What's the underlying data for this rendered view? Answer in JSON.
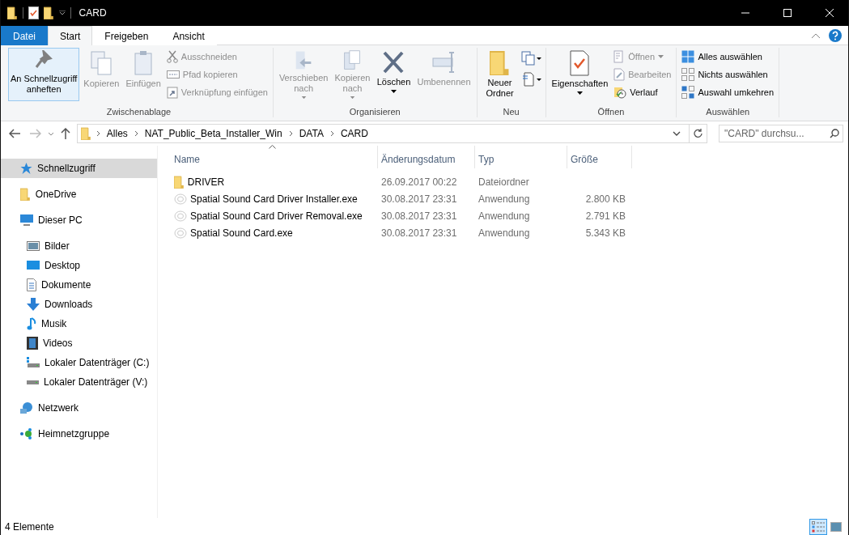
{
  "window": {
    "title": "CARD"
  },
  "ribbon": {
    "tabs": [
      {
        "label": "Datei",
        "kind": "file",
        "selected": false
      },
      {
        "label": "Start",
        "kind": "tab",
        "selected": true
      },
      {
        "label": "Freigeben",
        "kind": "tab",
        "selected": false
      },
      {
        "label": "Ansicht",
        "kind": "tab",
        "selected": false
      }
    ],
    "groups": [
      {
        "name": "Zwischenablage",
        "items": [
          {
            "label": "An Schnellzugriff\nanheften",
            "kind": "large",
            "disabled": false,
            "highlighted": true
          },
          {
            "label": "Kopieren",
            "kind": "large",
            "disabled": true,
            "highlighted": false
          },
          {
            "label": "Einfügen",
            "kind": "large",
            "disabled": true,
            "highlighted": false
          },
          {
            "kind": "stack",
            "items": [
              {
                "label": "Ausschneiden",
                "disabled": true
              },
              {
                "label": "Pfad kopieren",
                "disabled": true
              },
              {
                "label": "Verknüpfung einfügen",
                "disabled": true
              }
            ]
          }
        ]
      },
      {
        "name": "Organisieren",
        "items": [
          {
            "label": "Verschieben\nnach",
            "kind": "large",
            "disabled": true,
            "dropdown": true,
            "highlighted": false
          },
          {
            "label": "Kopieren\nnach",
            "kind": "large",
            "disabled": true,
            "dropdown": true,
            "highlighted": false
          },
          {
            "label": "Löschen",
            "kind": "large",
            "disabled": false,
            "dropdown": true,
            "highlighted": false
          },
          {
            "label": "Umbenennen",
            "kind": "large",
            "disabled": true,
            "highlighted": false
          }
        ]
      },
      {
        "name": "Neu",
        "items": [
          {
            "label": "Neuer\nOrdner",
            "kind": "large",
            "disabled": false,
            "highlighted": false
          },
          {
            "kind": "iconstack"
          }
        ]
      },
      {
        "name": "Öffnen",
        "items": [
          {
            "label": "Eigenschaften",
            "kind": "large",
            "disabled": false,
            "dropdown": true,
            "highlighted": false
          },
          {
            "kind": "stack",
            "items": [
              {
                "label": "Öffnen",
                "disabled": true,
                "dropdown": true
              },
              {
                "label": "Bearbeiten",
                "disabled": true
              },
              {
                "label": "Verlauf",
                "disabled": false
              }
            ]
          }
        ]
      },
      {
        "name": "Auswählen",
        "items": [
          {
            "kind": "stack",
            "items": [
              {
                "label": "Alles auswählen",
                "disabled": false
              },
              {
                "label": "Nichts auswählen",
                "disabled": false
              },
              {
                "label": "Auswahl umkehren",
                "disabled": false
              }
            ]
          }
        ]
      }
    ]
  },
  "navigation": {
    "back_disabled": false,
    "forward_disabled": true
  },
  "address": {
    "path": [
      "Alles",
      "NAT_Public_Beta_Installer_Win",
      "DATA",
      "CARD"
    ]
  },
  "search": {
    "placeholder": "\"CARD\" durchsu..."
  },
  "sidebar": {
    "items": [
      {
        "label": "Schnellzugriff",
        "selected": true
      },
      {
        "label": "OneDrive",
        "selected": false
      },
      {
        "label": "Dieser PC",
        "selected": false,
        "children": [
          {
            "label": "Bilder",
            "selected": false
          },
          {
            "label": "Desktop",
            "selected": false
          },
          {
            "label": "Dokumente",
            "selected": false
          },
          {
            "label": "Downloads",
            "selected": false
          },
          {
            "label": "Musik",
            "selected": false
          },
          {
            "label": "Videos",
            "selected": false
          },
          {
            "label": "Lokaler Datenträger (C:)",
            "selected": false
          },
          {
            "label": "Lokaler Datenträger (V:)",
            "selected": false
          }
        ]
      },
      {
        "label": "Netzwerk",
        "selected": false
      },
      {
        "label": "Heimnetzgruppe",
        "selected": false
      }
    ]
  },
  "table": {
    "columns": [
      "Name",
      "Änderungsdatum",
      "Typ",
      "Größe"
    ],
    "rows": [
      {
        "kind": "folder",
        "name": "DRIVER",
        "date": "26.09.2017 00:22",
        "type": "Dateiordner"
      },
      {
        "kind": "app",
        "name": "Spatial Sound Card Driver Installer.exe",
        "date": "30.08.2017 23:31",
        "type": "Anwendung",
        "size": "2.800 KB"
      },
      {
        "kind": "app",
        "name": "Spatial Sound Card Driver Removal.exe",
        "date": "30.08.2017 23:31",
        "type": "Anwendung",
        "size": "2.791 KB"
      },
      {
        "kind": "app",
        "name": "Spatial Sound Card.exe",
        "date": "30.08.2017 23:31",
        "type": "Anwendung",
        "size": "5.343 KB"
      }
    ]
  },
  "status_bar": {
    "count": "4 Elemente",
    "views": [
      {
        "kind": "details",
        "selected": true
      },
      {
        "kind": "large_icons",
        "selected": false
      }
    ]
  }
}
